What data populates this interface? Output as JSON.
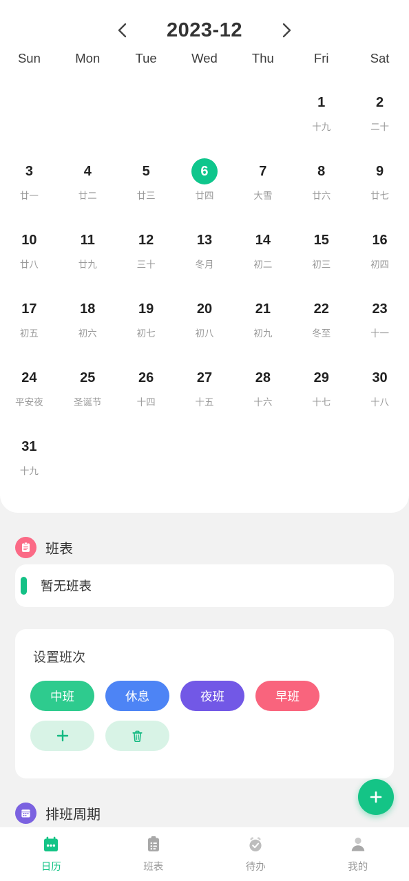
{
  "header": {
    "title": "2023-12",
    "prev_label": "‹",
    "next_label": "›"
  },
  "calendar": {
    "weekdays": [
      "Sun",
      "Mon",
      "Tue",
      "Wed",
      "Thu",
      "Fri",
      "Sat"
    ],
    "selected_day": "6",
    "accent_color": "#0fc68c",
    "weeks": [
      [
        {
          "day": "",
          "lunar": ""
        },
        {
          "day": "",
          "lunar": ""
        },
        {
          "day": "",
          "lunar": ""
        },
        {
          "day": "",
          "lunar": ""
        },
        {
          "day": "",
          "lunar": ""
        },
        {
          "day": "1",
          "lunar": "十九"
        },
        {
          "day": "2",
          "lunar": "二十"
        }
      ],
      [
        {
          "day": "3",
          "lunar": "廿一"
        },
        {
          "day": "4",
          "lunar": "廿二"
        },
        {
          "day": "5",
          "lunar": "廿三"
        },
        {
          "day": "6",
          "lunar": "廿四",
          "selected": true
        },
        {
          "day": "7",
          "lunar": "大雪"
        },
        {
          "day": "8",
          "lunar": "廿六"
        },
        {
          "day": "9",
          "lunar": "廿七"
        }
      ],
      [
        {
          "day": "10",
          "lunar": "廿八"
        },
        {
          "day": "11",
          "lunar": "廿九"
        },
        {
          "day": "12",
          "lunar": "三十"
        },
        {
          "day": "13",
          "lunar": "冬月"
        },
        {
          "day": "14",
          "lunar": "初二"
        },
        {
          "day": "15",
          "lunar": "初三"
        },
        {
          "day": "16",
          "lunar": "初四"
        }
      ],
      [
        {
          "day": "17",
          "lunar": "初五"
        },
        {
          "day": "18",
          "lunar": "初六"
        },
        {
          "day": "19",
          "lunar": "初七"
        },
        {
          "day": "20",
          "lunar": "初八"
        },
        {
          "day": "21",
          "lunar": "初九"
        },
        {
          "day": "22",
          "lunar": "冬至"
        },
        {
          "day": "23",
          "lunar": "十一"
        }
      ],
      [
        {
          "day": "24",
          "lunar": "平安夜"
        },
        {
          "day": "25",
          "lunar": "圣诞节"
        },
        {
          "day": "26",
          "lunar": "十四"
        },
        {
          "day": "27",
          "lunar": "十五"
        },
        {
          "day": "28",
          "lunar": "十六"
        },
        {
          "day": "29",
          "lunar": "十七"
        },
        {
          "day": "30",
          "lunar": "十八"
        }
      ],
      [
        {
          "day": "31",
          "lunar": "十九"
        },
        {
          "day": "",
          "lunar": ""
        },
        {
          "day": "",
          "lunar": ""
        },
        {
          "day": "",
          "lunar": ""
        },
        {
          "day": "",
          "lunar": ""
        },
        {
          "day": "",
          "lunar": ""
        },
        {
          "day": "",
          "lunar": ""
        }
      ]
    ]
  },
  "schedule_section": {
    "title": "班表",
    "icon": "clipboard-icon",
    "icon_color": "#fb6a86",
    "empty_text": "暂无班表",
    "accent_color": "#14c186"
  },
  "shift_settings": {
    "title": "设置班次",
    "chips": [
      {
        "label": "中班",
        "color": "#2ecb8e"
      },
      {
        "label": "休息",
        "color": "#4d84f5"
      },
      {
        "label": "夜班",
        "color": "#7258e6"
      },
      {
        "label": "早班",
        "color": "#f9647d"
      }
    ],
    "actions": [
      {
        "icon": "plus-icon",
        "label": ""
      },
      {
        "icon": "trash-icon",
        "label": ""
      }
    ],
    "action_bg": "#d8f3e6",
    "action_fg": "#12b981"
  },
  "cycle_section": {
    "title": "排班周期",
    "icon": "calendar-icon",
    "icon_color": "#7b62e0"
  },
  "fab": {
    "icon": "plus-icon",
    "color": "#14c486"
  },
  "bottom_nav": {
    "active_color": "#14c486",
    "items": [
      {
        "label": "日历",
        "icon": "calendar-icon",
        "active": true
      },
      {
        "label": "班表",
        "icon": "clipboard-list-icon",
        "active": false
      },
      {
        "label": "待办",
        "icon": "alarm-check-icon",
        "active": false
      },
      {
        "label": "我的",
        "icon": "person-icon",
        "active": false
      }
    ]
  }
}
